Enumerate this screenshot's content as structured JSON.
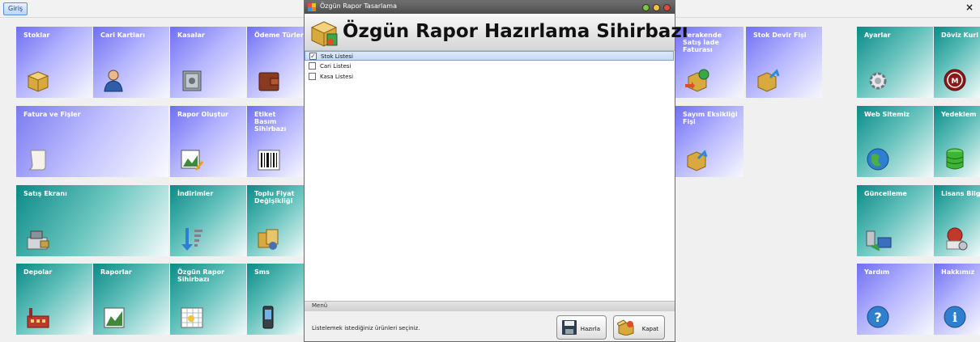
{
  "topbar": {
    "tab_label": "Giriş",
    "close_glyph": "×"
  },
  "tiles": {
    "stoklar": "Stoklar",
    "cari_kartlari": "Cari Kartları",
    "kasalar": "Kasalar",
    "odeme_turleri": "Ödeme Türleri",
    "perakende_satis_iade": "Perakende Satış İade Faturası",
    "stok_devir_fisi": "Stok Devir Fişi",
    "ayarlar": "Ayarlar",
    "doviz_kurlari": "Döviz Kurl",
    "fatura_ve_fisler": "Fatura ve Fişler",
    "rapor_olustur": "Rapor Oluştur",
    "etiket_basim": "Etiket Basım Sihirbazı",
    "sayim_eksikligi": "Sayım Eksikliği Fişi",
    "web_sitemiz": "Web Sitemiz",
    "yedekleme": "Yedeklem",
    "satis_ekrani": "Satış Ekranı",
    "indirimler": "İndirimler",
    "toplu_fiyat": "Toplu Fiyat Değişikliği",
    "guncelleme": "Güncelleme",
    "lisans_bilgileri": "Lisans Bilg",
    "depolar": "Depolar",
    "raporlar": "Raporlar",
    "ozgun_rapor": "Özgün Rapor Sihirbazı",
    "sms": "Sms",
    "yardim": "Yardım",
    "hakkimizda": "Hakkımız"
  },
  "dialog": {
    "window_title": "Özgün Rapor Tasarlama",
    "header_title": "Özgün Rapor Hazırlama Sihirbazı",
    "items": [
      {
        "label": "Stok Listesi",
        "checked": true,
        "check_glyph": "✓"
      },
      {
        "label": "Cari Listesi",
        "checked": false,
        "check_glyph": ""
      },
      {
        "label": "Kasa Listesi",
        "checked": false,
        "check_glyph": ""
      }
    ],
    "menu_label": "Menü",
    "hint": "Listelemek istediğiniz ürünleri seçiniz.",
    "prepare_button": "Hazırla",
    "close_button": "Kapat"
  },
  "colors": {
    "tile_blue": "#7a7af0",
    "tile_teal": "#0a8a87",
    "dialog_title_bar": "#5a5a5a",
    "selection": "#c5dbf7"
  }
}
